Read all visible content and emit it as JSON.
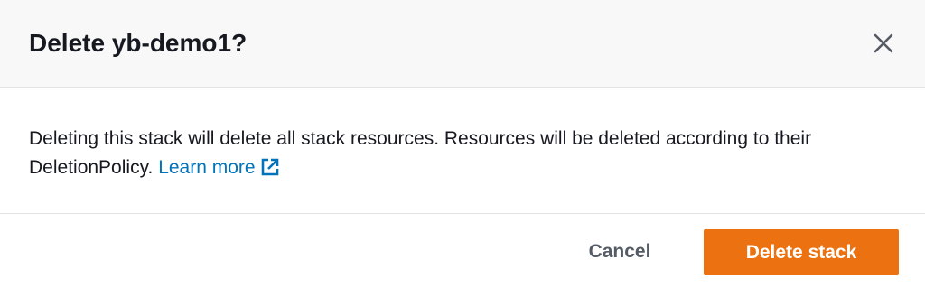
{
  "modal": {
    "title": "Delete yb-demo1?",
    "body_text": "Deleting this stack will delete all stack resources. Resources will be deleted according to their DeletionPolicy.",
    "learn_more_label": "Learn more",
    "cancel_label": "Cancel",
    "delete_label": "Delete stack"
  },
  "icons": {
    "close": "close-icon",
    "external_link": "external-link-icon"
  },
  "colors": {
    "header_background": "#f8f8f8",
    "primary_button": "#ec7211",
    "link": "#0073bb",
    "text": "#16191f",
    "secondary_text": "#545b64"
  }
}
